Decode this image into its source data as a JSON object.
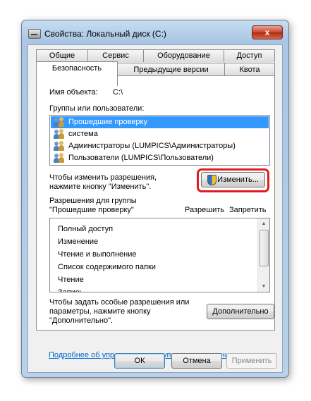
{
  "window": {
    "title": "Свойства: Локальный диск (C:)",
    "close_glyph": "x"
  },
  "tabs_row1": [
    {
      "label": "Общие"
    },
    {
      "label": "Сервис"
    },
    {
      "label": "Оборудование"
    },
    {
      "label": "Доступ"
    }
  ],
  "tabs_row2": [
    {
      "label": "Безопасность",
      "active": true
    },
    {
      "label": "Предыдущие версии"
    },
    {
      "label": "Квота"
    }
  ],
  "security": {
    "object_name_label": "Имя объекта:",
    "object_name_value": "C:\\",
    "groups_label": "Группы или пользователи:",
    "groups": [
      {
        "name": "Прошедшие проверку",
        "selected": true
      },
      {
        "name": "система"
      },
      {
        "name": "Администраторы (LUMPICS\\Администраторы)"
      },
      {
        "name": "Пользователи (LUMPICS\\Пользователи)"
      }
    ],
    "change_hint_line1": "Чтобы изменить разрешения,",
    "change_hint_line2": "нажмите кнопку \"Изменить\".",
    "change_button": "Изменить...",
    "perms_label_line1": "Разрешения для группы",
    "perms_label_line2": "\"Прошедшие проверку\"",
    "allow_header": "Разрешить",
    "deny_header": "Запретить",
    "permissions": [
      {
        "name": "Полный доступ"
      },
      {
        "name": "Изменение"
      },
      {
        "name": "Чтение и выполнение"
      },
      {
        "name": "Список содержимого папки"
      },
      {
        "name": "Чтение"
      },
      {
        "name": "Запись"
      }
    ],
    "advanced_hint_line1": "Чтобы задать особые разрешения или",
    "advanced_hint_line2": "параметры, нажмите кнопку",
    "advanced_hint_line3": "\"Дополнительно\".",
    "advanced_button": "Дополнительно",
    "link": "Подробнее об управлении доступом и разрешениях"
  },
  "footer": {
    "ok": "ОК",
    "cancel": "Отмена",
    "apply": "Применить"
  },
  "colors": {
    "selection": "#3399ff",
    "highlight_ring": "#e31b1b",
    "link": "#0066cc"
  }
}
